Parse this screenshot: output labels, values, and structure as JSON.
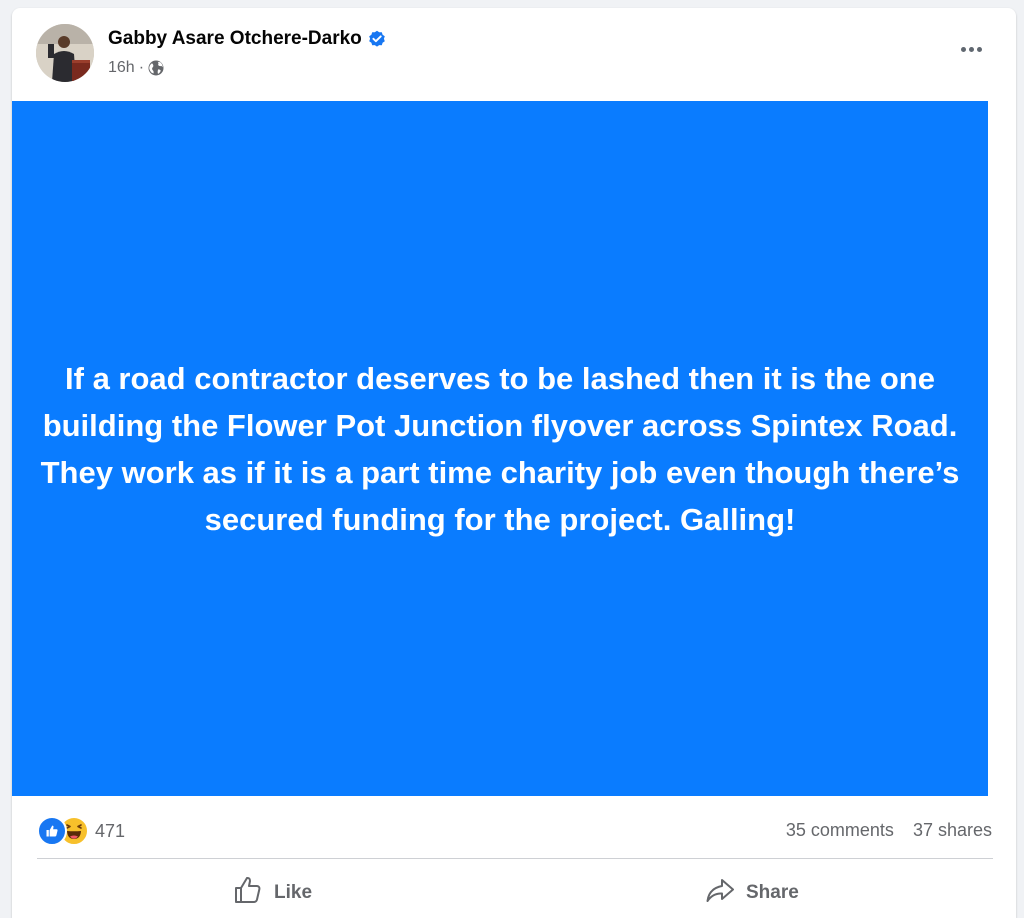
{
  "post": {
    "author": "Gabby Asare Otchere-Darko",
    "time": "16h",
    "separator": "·",
    "audience_icon": "globe-icon",
    "verified_icon": "verified-badge-icon",
    "body_text": "If a road contractor deserves to be lashed then it is the one building the Flower Pot Junction flyover across Spintex Road. They work as if it is a part time charity job even though there’s secured funding for the project. Galling!",
    "background_color": "#0a7cff",
    "text_color": "#ffffff"
  },
  "stats": {
    "reaction_icons": [
      "like-reaction-icon",
      "haha-reaction-icon"
    ],
    "reaction_count": "471",
    "comments": "35 comments",
    "shares": "37 shares"
  },
  "actions": {
    "like_label": "Like",
    "share_label": "Share"
  },
  "colors": {
    "accent": "#1877f2",
    "secondary_text": "#65676b",
    "page_background": "#f0f2f5"
  }
}
